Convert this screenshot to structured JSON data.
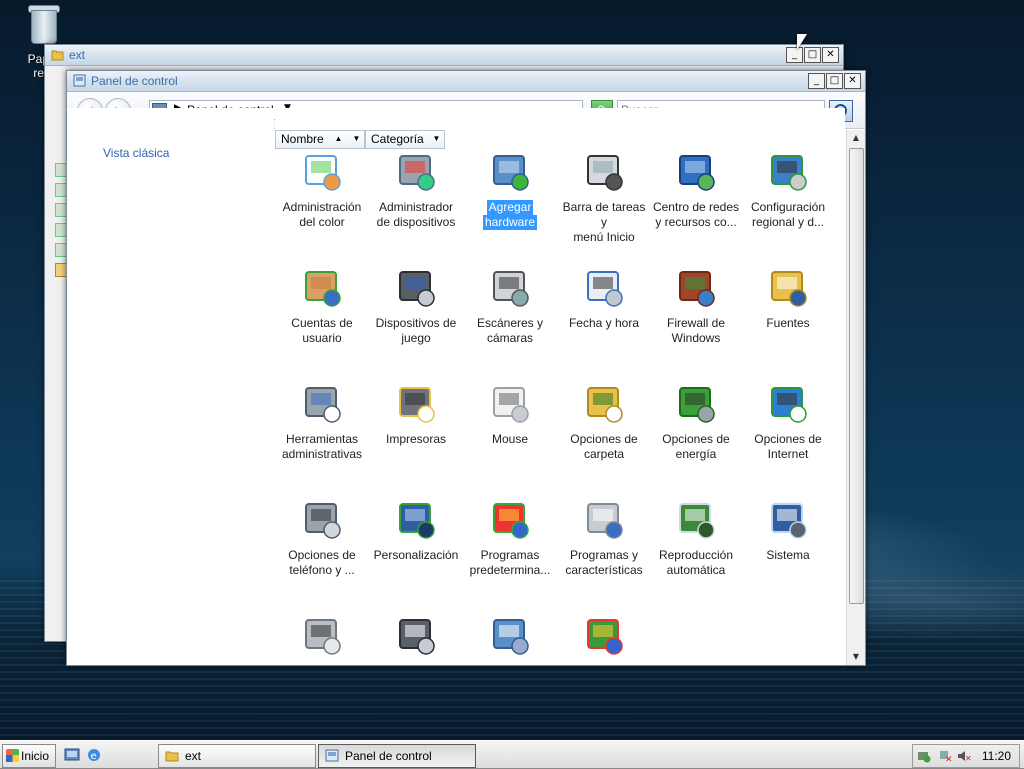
{
  "desktop": {
    "recycle_bin_label_1": "Papel",
    "recycle_bin_label_2": "reci"
  },
  "back_window": {
    "title": "ext",
    "minimize": "_",
    "maximize": "□",
    "close": "✕"
  },
  "front_window": {
    "title": "Panel de control",
    "minimize": "_",
    "maximize": "□",
    "close": "✕",
    "address": "Panel de control",
    "search_placeholder": "Buscar",
    "left_link": "Vista clásica",
    "columns": [
      {
        "label": "Nombre"
      },
      {
        "label": "Categoría"
      }
    ],
    "items": [
      {
        "label_1": "Administración",
        "label_2": "del color",
        "icon": "color-management-icon"
      },
      {
        "label_1": "Administrador",
        "label_2": "de dispositivos",
        "icon": "device-manager-icon"
      },
      {
        "label_1": "Agregar",
        "label_2": "hardware",
        "icon": "add-hardware-icon",
        "selected": true
      },
      {
        "label_1": "Barra de tareas y",
        "label_2": "menú Inicio",
        "icon": "taskbar-icon"
      },
      {
        "label_1": "Centro de redes",
        "label_2": "y recursos co...",
        "icon": "network-center-icon"
      },
      {
        "label_1": "Configuración",
        "label_2": "regional y d...",
        "icon": "regional-settings-icon"
      },
      {
        "label_1": "Cuentas de",
        "label_2": "usuario",
        "icon": "user-accounts-icon"
      },
      {
        "label_1": "Dispositivos de",
        "label_2": "juego",
        "icon": "game-controllers-icon"
      },
      {
        "label_1": "Escáneres y",
        "label_2": "cámaras",
        "icon": "scanners-icon"
      },
      {
        "label_1": "Fecha y hora",
        "label_2": "",
        "icon": "date-time-icon"
      },
      {
        "label_1": "Firewall de",
        "label_2": "Windows",
        "icon": "firewall-icon"
      },
      {
        "label_1": "Fuentes",
        "label_2": "",
        "icon": "fonts-icon"
      },
      {
        "label_1": "Herramientas",
        "label_2": "administrativas",
        "icon": "admin-tools-icon"
      },
      {
        "label_1": "Impresoras",
        "label_2": "",
        "icon": "printers-icon"
      },
      {
        "label_1": "Mouse",
        "label_2": "",
        "icon": "mouse-icon"
      },
      {
        "label_1": "Opciones de",
        "label_2": "carpeta",
        "icon": "folder-options-icon"
      },
      {
        "label_1": "Opciones de",
        "label_2": "energía",
        "icon": "power-options-icon"
      },
      {
        "label_1": "Opciones de",
        "label_2": "Internet",
        "icon": "internet-options-icon"
      },
      {
        "label_1": "Opciones de",
        "label_2": "teléfono y ...",
        "icon": "phone-modem-icon"
      },
      {
        "label_1": "Personalización",
        "label_2": "",
        "icon": "personalization-icon"
      },
      {
        "label_1": "Programas",
        "label_2": "predetermina...",
        "icon": "default-programs-icon"
      },
      {
        "label_1": "Programas y",
        "label_2": "características",
        "icon": "programs-features-icon"
      },
      {
        "label_1": "Reproducción",
        "label_2": "automática",
        "icon": "autoplay-icon"
      },
      {
        "label_1": "Sistema",
        "label_2": "",
        "icon": "system-icon"
      },
      {
        "label_1": "",
        "label_2": "",
        "icon": "sound-icon"
      },
      {
        "label_1": "",
        "label_2": "",
        "icon": "keyboard-icon"
      },
      {
        "label_1": "",
        "label_2": "",
        "icon": "speech-icon"
      },
      {
        "label_1": "",
        "label_2": "",
        "icon": "windows-update-icon"
      }
    ]
  },
  "taskbar": {
    "start_label": "Inicio",
    "tasks": [
      {
        "label": "ext"
      },
      {
        "label": "Panel de control"
      }
    ],
    "clock": "11:20"
  },
  "colors": {
    "accent": "#3399ff",
    "link": "#2b63b7",
    "title_text": "#3b6ea5"
  }
}
